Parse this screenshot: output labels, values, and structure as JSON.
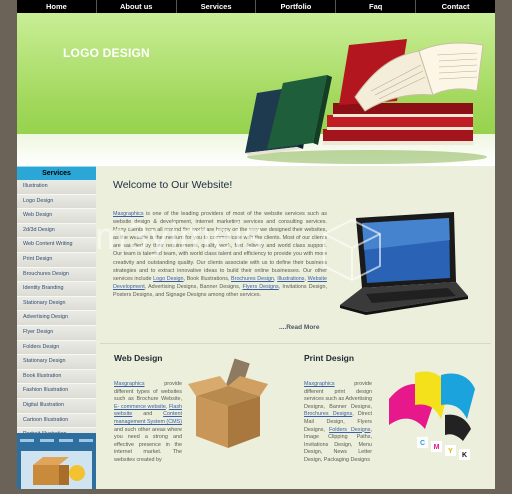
{
  "nav": {
    "items": [
      "Home",
      "About us",
      "Services",
      "Portfolio",
      "Faq",
      "Contact"
    ]
  },
  "header": {
    "logo_text": "LOGO DESIGN"
  },
  "sidebar": {
    "title": "Services",
    "items": [
      "Illustration",
      "Logo Design",
      "Web Design",
      "2d/3d Design",
      "Web Content Writing",
      "Print Design",
      "Brouchures Design",
      "Identity Branding",
      "Stationary Design",
      "Advertising Design",
      "Flyer Design",
      "Folders Design",
      "Stationary Design",
      "Book Illustration",
      "Fashion Illustration",
      "Digital Illustration",
      "Cartoon Illustration",
      "Portrait Illustration"
    ]
  },
  "welcome": {
    "title": "Welcome to Our Website!",
    "company_link": "Maxgraphics",
    "p1": " is one of the leading providers of most of the website services such as website design & development, internet marketing services and consulting services. Many clients from all around the world are happy on the way we designed their websites, as the website is the medium for you to communicate with the clients. Most of our clients are satisfied by their requirements, quality work, fast delivery and world class support. Our team is talented team, with world class talent and efficiency to provide you with more creativity and outstanding quality. Our clients associate with us to define their business strategies and to extract innovative ideas to build their online businesses. Our other services include ",
    "links": [
      "Logo Design",
      "Brochures Design",
      "Illustrations",
      "Website Development",
      "Flyers Designs"
    ],
    "t1": ", Book Illustrations, ",
    "t2": ", ",
    "t3": ", ",
    "t4": ", Advertising Designs, Banner Designs, ",
    "t5": ", Invitations Design, Posters Designs, and Signage Designs among other services.",
    "read_more": "....Read More"
  },
  "web_design": {
    "title": "Web Design",
    "link1": "Maxgraphics",
    "text1": " provide different types of websites such as Brochure Website, ",
    "link2": "E- commerce website",
    "text2": ", ",
    "link3": "Flash website",
    "text3": " and ",
    "link4": "Content management System (CMS)",
    "text4": " and such other areas where you need a strong and effective presence in the internet market. The websites created by"
  },
  "print_design": {
    "title": "Print Design",
    "link1": "Maxgraphics",
    "text1": " provide different print design services such as Advertising Designs, Banner Designs, ",
    "link2": "Brochures Designs",
    "text2": ", Direct Mail Design, Flyers Designs, ",
    "link3": "Folders Designs",
    "text3": ", Image Clipping Paths, Invitations Design, Menu Design, News Letter Design, Packaging Designs"
  },
  "cmyk_letters": [
    "C",
    "M",
    "Y",
    "K"
  ],
  "watermark": "m3yimeis"
}
